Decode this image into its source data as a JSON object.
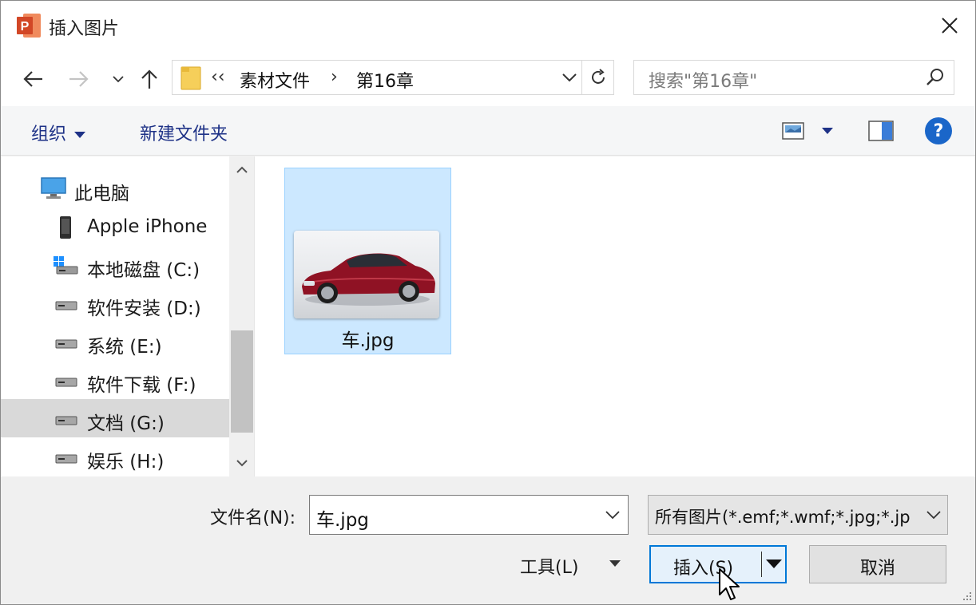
{
  "window": {
    "title": "插入图片",
    "app_icon": "powerpoint-icon",
    "app_icon_letter": "P",
    "accent": "#d24726"
  },
  "navigation": {
    "back_icon": "arrow-left-icon",
    "forward_icon": "arrow-right-icon",
    "recent_icon": "chevron-down-icon",
    "up_icon": "arrow-up-icon"
  },
  "address": {
    "overflow": "‹‹",
    "crumbs": [
      "素材文件",
      "第16章"
    ],
    "separator": "›",
    "refresh_icon": "refresh-icon"
  },
  "search": {
    "placeholder": "搜索\"第16章\""
  },
  "command_bar": {
    "organize": "组织",
    "new_folder": "新建文件夹",
    "help": "?"
  },
  "nav_tree": {
    "root": "此电脑",
    "items": [
      {
        "label": "Apple iPhone",
        "icon": "phone-icon"
      },
      {
        "label": "本地磁盘 (C:)",
        "icon": "windows-drive-icon"
      },
      {
        "label": "软件安装 (D:)",
        "icon": "drive-icon"
      },
      {
        "label": "系统 (E:)",
        "icon": "drive-icon"
      },
      {
        "label": "软件下载 (F:)",
        "icon": "drive-icon"
      },
      {
        "label": "文档 (G:)",
        "icon": "drive-icon",
        "selected": true
      },
      {
        "label": "娱乐 (H:)",
        "icon": "drive-icon"
      }
    ]
  },
  "files": [
    {
      "name": "车.jpg",
      "selected": true,
      "thumbnail": "red-car-image"
    }
  ],
  "footer": {
    "filename_label": "文件名(N):",
    "filename_value": "车.jpg",
    "filetype_value": "所有图片(*.emf;*.wmf;*.jpg;*.jp",
    "tools_label": "工具(L)",
    "insert_label": "插入(S)",
    "cancel_label": "取消"
  },
  "colors": {
    "selection": "#cce8ff",
    "selection_border": "#99d1ff",
    "link_blue": "#1e3287",
    "help_blue": "#1a66c9",
    "focus_border": "#0078d7"
  }
}
